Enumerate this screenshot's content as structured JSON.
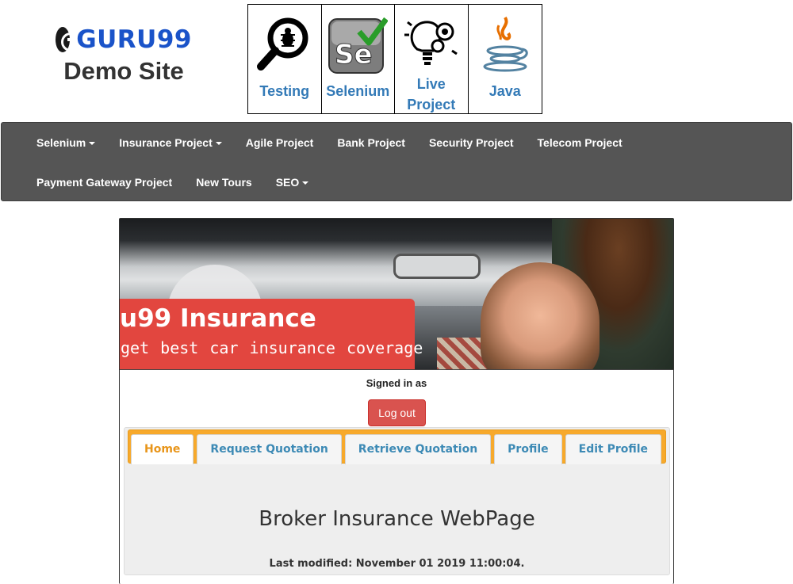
{
  "header": {
    "brand": "GURU99",
    "subtitle": "Demo Site"
  },
  "courses": [
    {
      "label": "Testing",
      "icon": "magnifier-bug-icon"
    },
    {
      "label": "Selenium",
      "icon": "selenium-logo-icon"
    },
    {
      "label": "Live Project",
      "icon": "lightbulb-gears-icon"
    },
    {
      "label": "Java",
      "icon": "java-logo-icon"
    }
  ],
  "nav": {
    "row1": [
      {
        "label": "Selenium",
        "dropdown": true
      },
      {
        "label": "Insurance Project",
        "dropdown": true
      },
      {
        "label": "Agile Project",
        "dropdown": false
      },
      {
        "label": "Bank Project",
        "dropdown": false
      },
      {
        "label": "Security Project",
        "dropdown": false
      },
      {
        "label": "Telecom Project",
        "dropdown": false
      }
    ],
    "row2": [
      {
        "label": "Payment Gateway Project",
        "dropdown": false
      },
      {
        "label": "New Tours",
        "dropdown": false
      },
      {
        "label": "SEO",
        "dropdown": true
      }
    ]
  },
  "banner": {
    "title": "u99 Insurance",
    "subtitle": "get best car insurance coverage"
  },
  "account": {
    "signed_in": "Signed in as",
    "logout_label": "Log out"
  },
  "tabs": [
    {
      "label": "Home",
      "active": true
    },
    {
      "label": "Request Quotation",
      "active": false
    },
    {
      "label": "Retrieve Quotation",
      "active": false
    },
    {
      "label": "Profile",
      "active": false
    },
    {
      "label": "Edit Profile",
      "active": false
    }
  ],
  "content": {
    "title": "Broker Insurance WebPage",
    "last_modified": "Last modified: November 01 2019 11:00:04."
  },
  "colors": {
    "brand_blue": "#1a53c9",
    "nav_bg": "#555555",
    "logout_red": "#d9534f",
    "tab_bar_orange": "#f7a92b",
    "tab_active_text": "#e8951a",
    "tab_text": "#3d8ab5",
    "course_label": "#337ab7"
  }
}
